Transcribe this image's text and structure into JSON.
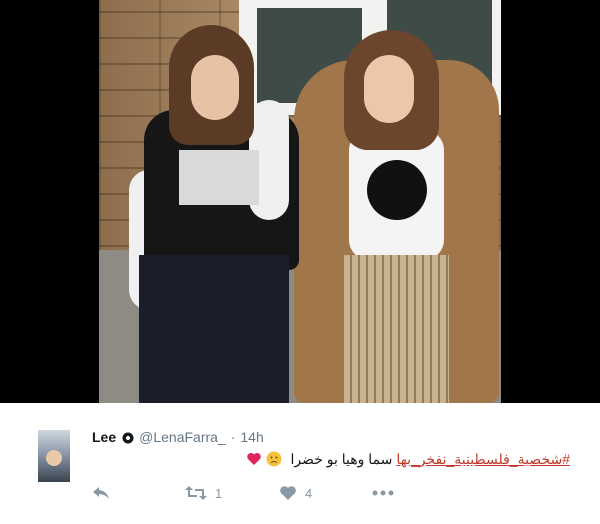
{
  "tweet": {
    "display_name": "Lee",
    "handle": "@LenaFarra_",
    "separator": "·",
    "time": "14h",
    "hashtag": "#شخصية_فلسطينية_نفخر_بها",
    "text": "سما وهيا بو خضرا",
    "emojis": [
      "slightly-frowning-face-emoji",
      "red-heart-emoji"
    ]
  },
  "actions": {
    "reply": {
      "icon": "reply-icon",
      "count": ""
    },
    "retweet": {
      "icon": "retweet-icon",
      "count": "1"
    },
    "like": {
      "icon": "heart-icon",
      "count": "4"
    },
    "more": {
      "icon": "more-dots-icon"
    }
  },
  "colors": {
    "viewer_background": "#000000",
    "hashtag": "#c0392b",
    "meta_text": "#657786",
    "action_icon": "#8899a6"
  }
}
